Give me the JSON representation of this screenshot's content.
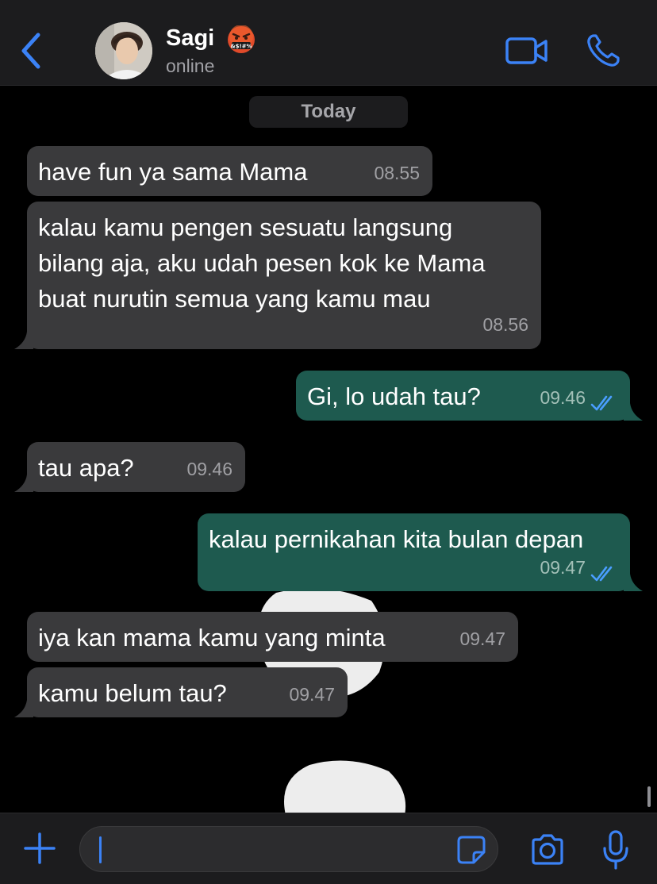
{
  "header": {
    "contact_name": "Sagi",
    "status": "online",
    "emoji_icon": "cursing-face-emoji",
    "accent_color": "#3b82f6"
  },
  "chat": {
    "date_separator": "Today",
    "messages": [
      {
        "direction": "incoming",
        "text": "have fun ya sama Mama",
        "time": "08.55"
      },
      {
        "direction": "incoming",
        "lines": [
          "kalau kamu pengen sesuatu langsung",
          "bilang aja, aku udah pesen kok ke Mama",
          "buat nurutin semua yang kamu mau"
        ],
        "time": "08.56"
      },
      {
        "direction": "outgoing",
        "text": "Gi, lo udah tau?",
        "time": "09.46",
        "status": "read"
      },
      {
        "direction": "incoming",
        "text": "tau apa?",
        "time": "09.46"
      },
      {
        "direction": "outgoing",
        "text": "kalau pernikahan kita bulan depan",
        "time": "09.47",
        "status": "read"
      },
      {
        "direction": "incoming",
        "text": "iya kan mama kamu yang minta",
        "time": "09.47"
      },
      {
        "direction": "incoming",
        "text": "kamu belum tau?",
        "time": "09.47"
      }
    ]
  },
  "input": {
    "value": "",
    "icons": [
      "plus-icon",
      "sticker-icon",
      "camera-icon",
      "microphone-icon"
    ]
  },
  "colors": {
    "incoming_bubble": "#3a3a3c",
    "outgoing_bubble": "#1e5a4f",
    "read_ticks": "#4a9eff"
  }
}
